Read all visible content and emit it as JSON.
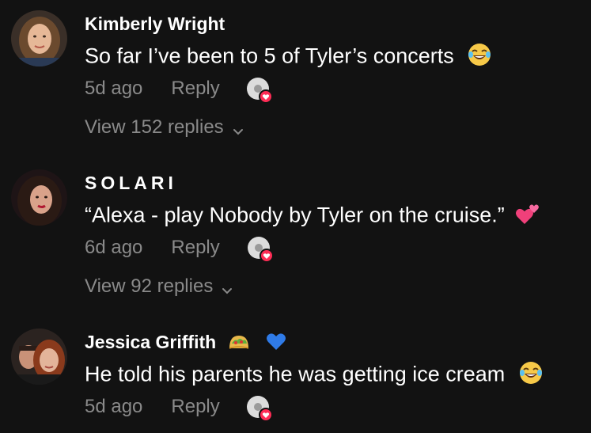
{
  "comments": [
    {
      "username": "Kimberly Wright",
      "text": "So far I’ve been to 5 of Tyler’s concerts",
      "trailing_emoji": "joy-emoji",
      "time": "5d ago",
      "reply_label": "Reply",
      "view_replies": "View 152 replies"
    },
    {
      "username": "SOLARI",
      "text": "“Alexa - play Nobody by Tyler on the cruise.”",
      "trailing_emoji": "two-hearts-emoji",
      "time": "6d ago",
      "reply_label": "Reply",
      "view_replies": "View 92 replies"
    },
    {
      "username": "Jessica Griffith",
      "name_emojis": [
        "taco-emoji",
        "blue-heart-emoji"
      ],
      "text": "He told his parents he was getting ice cream",
      "trailing_emoji": "joy-emoji",
      "time": "5d ago",
      "reply_label": "Reply"
    }
  ],
  "colors": {
    "background": "#121212",
    "primary_text": "#ffffff",
    "secondary_text": "#8a8a8a",
    "heart_badge": "#fe2c55"
  }
}
